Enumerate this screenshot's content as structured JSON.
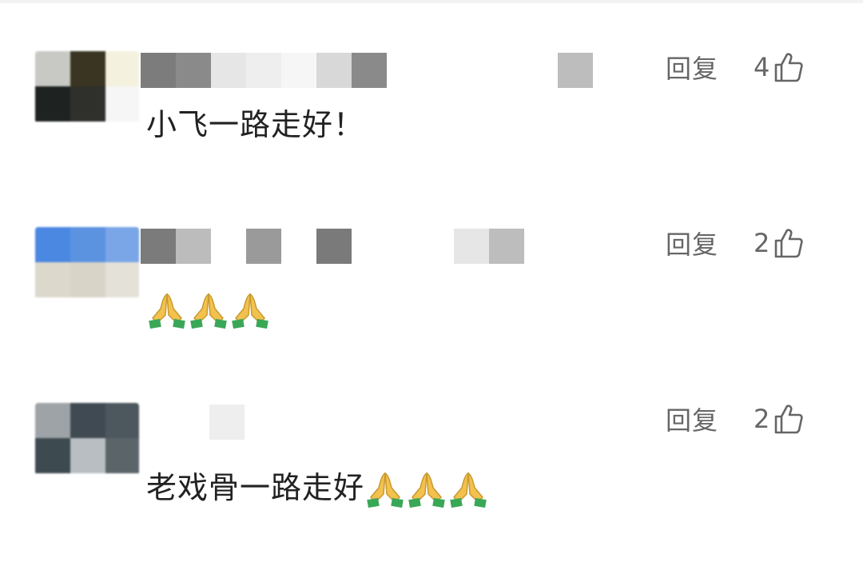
{
  "comments": [
    {
      "reply_label": "回复",
      "likes": "4",
      "text": "小飞一路走好！",
      "emoji_count": 0
    },
    {
      "reply_label": "回复",
      "likes": "2",
      "text": "",
      "emoji_count": 3
    },
    {
      "reply_label": "回复",
      "likes": "2",
      "text": "老戏骨一路走好",
      "emoji_count": 3
    }
  ],
  "icons": {
    "like": "thumbs-up-icon",
    "emoji": "folded-hands-emoji"
  },
  "colors": {
    "text": "#222222",
    "meta": "#666666",
    "background": "#ffffff",
    "emoji_sleeve": "#3aa757",
    "emoji_hand": "#f2c14e"
  }
}
